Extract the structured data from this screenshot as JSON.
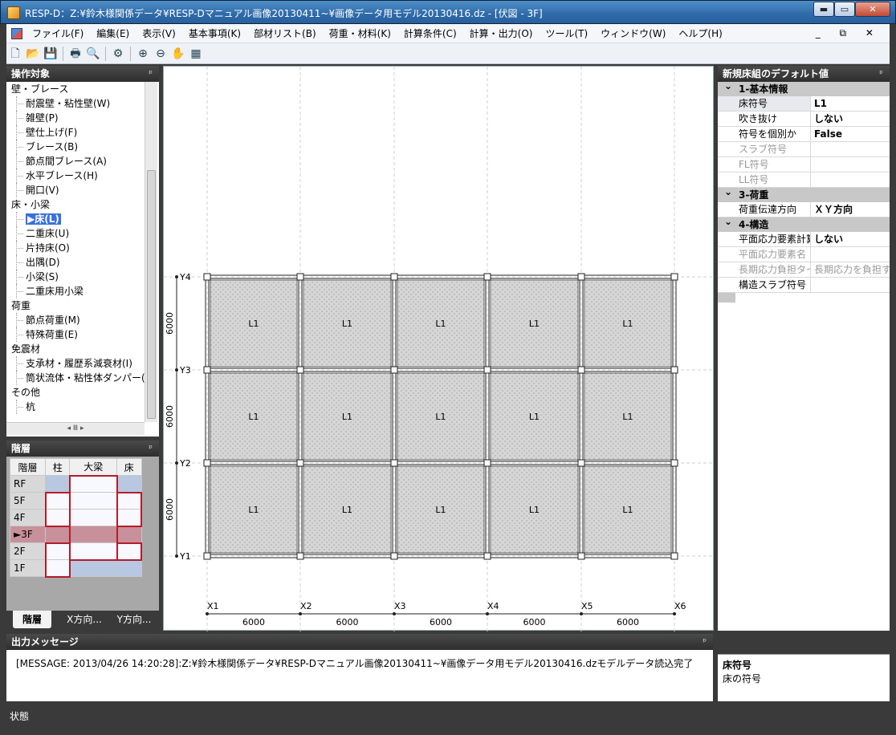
{
  "window": {
    "title": "RESP-D：Z:¥鈴木様関係データ¥RESP-Dマニュアル画像20130411~¥画像データ用モデル20130416.dz - [伏図 - 3F]",
    "min": "▬",
    "max": "▭",
    "close": "✕"
  },
  "menu": [
    "ファイル(F)",
    "編集(E)",
    "表示(V)",
    "基本事項(K)",
    "部材リスト(B)",
    "荷重・材料(K)",
    "計算条件(C)",
    "計算・出力(O)",
    "ツール(T)",
    "ウィンドウ(W)",
    "ヘルプ(H)"
  ],
  "mdi_controls": "_ ⧉ ✕",
  "toolbar": {
    "new": "🗋",
    "open": "📂",
    "save": "💾",
    "print": "🖶",
    "preview": "🔍",
    "settings": "⚙",
    "zoom_in": "⊕",
    "zoom_out": "⊖",
    "pan": "✋",
    "grid": "▦"
  },
  "target_panel": {
    "title": "操作対象",
    "pin": "ᵖ",
    "tree": [
      {
        "label": "壁・ブレース",
        "level": 0
      },
      {
        "label": "耐震壁・粘性壁(W)",
        "level": 1
      },
      {
        "label": "雑壁(P)",
        "level": 1
      },
      {
        "label": "壁仕上げ(F)",
        "level": 1
      },
      {
        "label": "ブレース(B)",
        "level": 1
      },
      {
        "label": "節点間ブレース(A)",
        "level": 1
      },
      {
        "label": "水平ブレース(H)",
        "level": 1
      },
      {
        "label": "開口(V)",
        "level": 1
      },
      {
        "label": "床・小梁",
        "level": 0
      },
      {
        "label": "▶床(L)",
        "level": 1,
        "selected": true
      },
      {
        "label": "二重床(U)",
        "level": 1
      },
      {
        "label": "片持床(O)",
        "level": 1
      },
      {
        "label": "出隅(D)",
        "level": 1
      },
      {
        "label": "小梁(S)",
        "level": 1
      },
      {
        "label": "二重床用小梁",
        "level": 1
      },
      {
        "label": "荷重",
        "level": 0
      },
      {
        "label": "節点荷重(M)",
        "level": 1
      },
      {
        "label": "特殊荷重(E)",
        "level": 1
      },
      {
        "label": "免震材",
        "level": 0
      },
      {
        "label": "支承材・履歴系減衰材(I)",
        "level": 1
      },
      {
        "label": "筒状流体・粘性体ダンパー(R)",
        "level": 1
      },
      {
        "label": "その他",
        "level": 0
      },
      {
        "label": "杭",
        "level": 1
      }
    ],
    "hscroll": "◂  Ⅲ  ▸"
  },
  "floor_panel": {
    "title": "階層",
    "pin": "ᵖ",
    "headers": [
      "階層",
      "柱",
      "大梁",
      "床"
    ],
    "rows": [
      {
        "floor": "RF",
        "col": "b",
        "beam": "c",
        "slab": "b"
      },
      {
        "floor": "5F",
        "col": "c",
        "beam": "c",
        "slab": "c"
      },
      {
        "floor": "4F",
        "col": "c",
        "beam": "c",
        "slab": "c"
      },
      {
        "floor": "►3F",
        "col": "c",
        "beam": "c",
        "slab": "c",
        "current": true
      },
      {
        "floor": "2F",
        "col": "c",
        "beam": "c",
        "slab": "c"
      },
      {
        "floor": "1F",
        "col": "c",
        "beam": "b",
        "slab": "b"
      }
    ],
    "tabs": [
      "階層",
      "X方向...",
      "Y方向..."
    ]
  },
  "plan": {
    "x_labels": [
      "X1",
      "X2",
      "X3",
      "X4",
      "X5",
      "X6"
    ],
    "y_labels": [
      "Y1",
      "Y2",
      "Y3",
      "Y4"
    ],
    "x_spans": [
      "6000",
      "6000",
      "6000",
      "6000",
      "6000"
    ],
    "y_spans": [
      "6000",
      "6000",
      "6000"
    ],
    "slab_label": "L1"
  },
  "output": {
    "title": "出力メッセージ",
    "pin": "ᵖ",
    "message": "[MESSAGE: 2013/04/26 14:20:28]:Z:¥鈴木様関係データ¥RESP-Dマニュアル画像20130411~¥画像データ用モデル20130416.dzモデルデータ読込完了"
  },
  "props": {
    "title": "新規床組のデフォルト値",
    "pin": "ᵖ",
    "sections": [
      {
        "name": "1-基本情報",
        "rows": [
          {
            "k": "床符号",
            "v": "L1",
            "hl": true
          },
          {
            "k": "吹き抜け",
            "v": "しない"
          },
          {
            "k": "符号を個別か",
            "v": "False"
          },
          {
            "k": "スラブ符号",
            "v": "",
            "dis": true
          },
          {
            "k": "FL符号",
            "v": "",
            "dis": true
          },
          {
            "k": "LL符号",
            "v": "",
            "dis": true
          }
        ]
      },
      {
        "name": "3-荷重",
        "rows": [
          {
            "k": "荷重伝達方向",
            "v": "ＸＹ方向"
          }
        ]
      },
      {
        "name": "4-構造",
        "rows": [
          {
            "k": "平面応力要素計算",
            "v": "しない"
          },
          {
            "k": "平面応力要素名",
            "v": "",
            "dis": true
          },
          {
            "k": "長期応力負担タイプ",
            "v": "長期応力を負担する",
            "dis": true
          },
          {
            "k": "構造スラブ符号",
            "v": ""
          }
        ]
      }
    ],
    "desc_title": "床符号",
    "desc_text": "床の符号"
  },
  "status": "状態"
}
